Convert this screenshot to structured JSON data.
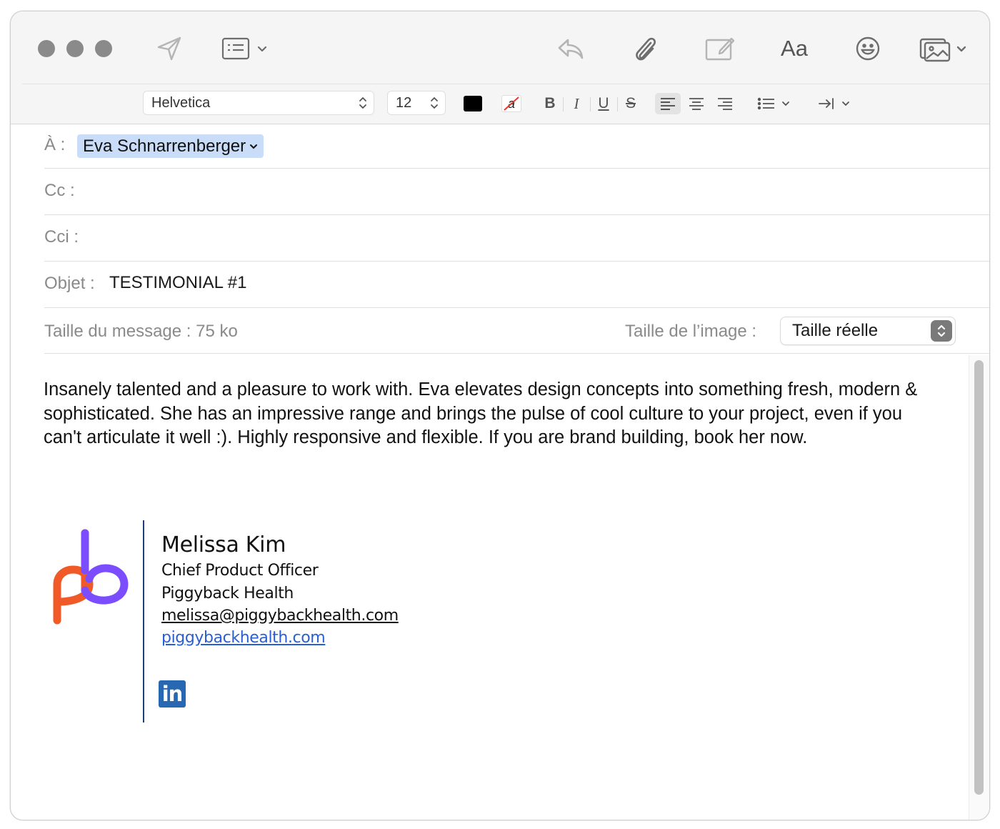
{
  "toolbar": {
    "font_family": "Helvetica",
    "font_size": "12",
    "aa_label": "Aa",
    "text_color": "#000000",
    "highlight_glyph": "a",
    "bold": "B",
    "italic": "I",
    "underline": "U",
    "strike": "S"
  },
  "headers": {
    "to_label": "À :",
    "to_recipient": "Eva Schnarrenberger",
    "cc_label": "Cc :",
    "bcc_label": "Cci :",
    "subject_label": "Objet :",
    "subject_value": "TESTIMONIAL #1",
    "message_size": "Taille du message : 75 ko",
    "image_size_label": "Taille de l’image :",
    "image_size_value": "Taille réelle"
  },
  "message": {
    "body": "Insanely talented and a pleasure to work with. Eva elevates design concepts into something fresh, modern & sophisticated. She has an impressive range and brings the pulse of cool culture to your project, even if you can't articulate it well :). Highly responsive and flexible. If you are brand building, book her now."
  },
  "signature": {
    "name": "Melissa Kim",
    "title": "Chief Product Officer",
    "company": "Piggyback Health",
    "email": "melissa@piggybackhealth.com",
    "website": "piggybackhealth.com",
    "linkedin_text": "in",
    "logo_colors": {
      "orange": "#f05a28",
      "purple": "#7b4dff"
    }
  }
}
